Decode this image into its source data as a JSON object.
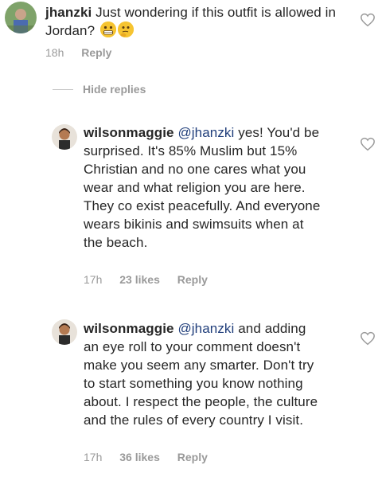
{
  "comments": [
    {
      "username": "jhanzki",
      "text": "Just wondering if this outfit is allowed in Jordan?",
      "time": "18h",
      "reply_label": "Reply",
      "emojis": [
        "grimacing-face",
        "thinking-face"
      ]
    },
    {
      "username": "wilsonmaggie",
      "mention": "@jhanzki",
      "text": "yes! You'd be surprised. It's 85% Muslim but 15% Christian and no one cares what you wear and what religion you are here. They co exist peacefully. And everyone wears bikinis and swimsuits when at the beach.",
      "time": "17h",
      "likes": "23 likes",
      "reply_label": "Reply"
    },
    {
      "username": "wilsonmaggie",
      "mention": "@jhanzki",
      "text": "and adding an eye roll to your comment doesn't make you seem any smarter. Don't try to start something you know nothing about. I respect the people, the culture and the rules of every country I visit.",
      "time": "17h",
      "likes": "36 likes",
      "reply_label": "Reply"
    }
  ],
  "hide_replies_label": "Hide replies",
  "colors": {
    "text": "#262626",
    "meta": "#9a9a9a",
    "mention": "#1f3d7a",
    "divider": "#c7c7c7"
  }
}
